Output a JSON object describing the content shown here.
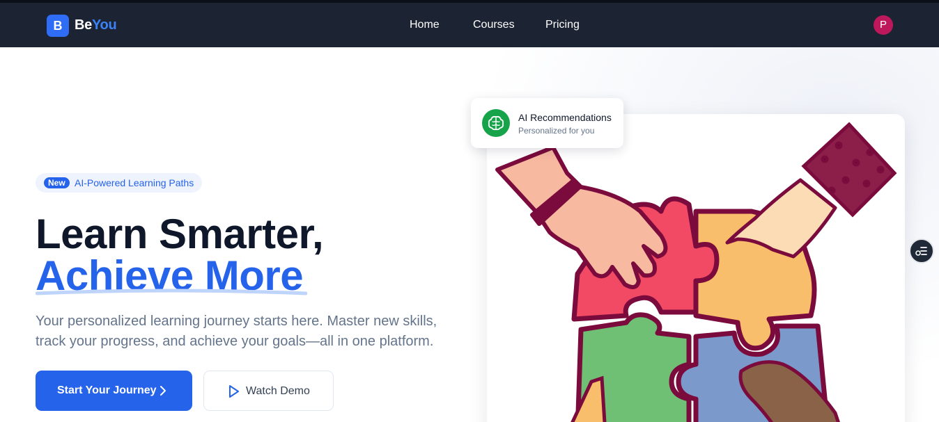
{
  "nav": {
    "logo_letter": "B",
    "logo_be": "Be",
    "logo_you": "You",
    "links": [
      "Home",
      "Courses",
      "Pricing"
    ],
    "avatar_initial": "P"
  },
  "hero": {
    "badge_new": "New",
    "badge_text": "AI-Powered Learning Paths",
    "title_line1": "Learn Smarter,",
    "title_line2": "Achieve More",
    "subtitle_line1": "Your personalized learning journey starts here. Master new skills,",
    "subtitle_line2": "track your progress, and achieve your goals—all in one platform.",
    "primary_button": "Start Your Journey",
    "secondary_button": "Watch Demo"
  },
  "ai_card": {
    "title": "AI Recommendations",
    "subtitle": "Personalized for you"
  },
  "colors": {
    "nav_bg": "#1c2333",
    "brand_blue": "#2563eb",
    "avatar": "#be185d",
    "ai_green": "#16a34a"
  },
  "icons": {
    "primary_button": "chevron-right-icon",
    "secondary_button": "play-icon",
    "ai_card": "brain-icon",
    "floating": "list-settings-icon"
  }
}
